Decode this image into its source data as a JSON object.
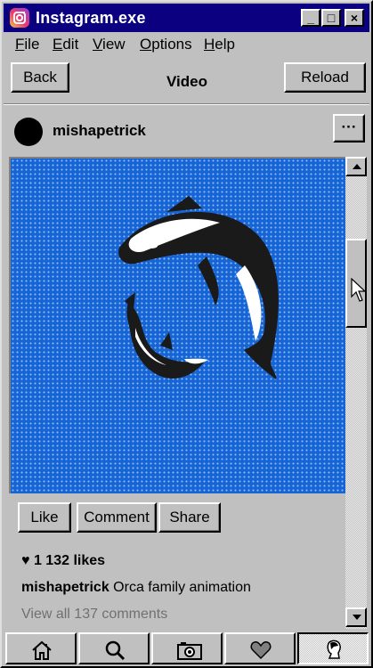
{
  "window": {
    "title": "Instagram.exe",
    "controls": {
      "minimize": "_",
      "maximize": "□",
      "close": "×"
    }
  },
  "menu": [
    {
      "key": "F",
      "rest": "ile"
    },
    {
      "key": "E",
      "rest": "dit"
    },
    {
      "key": "V",
      "rest": "iew"
    },
    {
      "key": "O",
      "rest": "ptions"
    },
    {
      "key": "H",
      "rest": "elp"
    }
  ],
  "header": {
    "back_label": "Back",
    "title": "Video",
    "reload_label": "Reload"
  },
  "post": {
    "username": "mishapetrick",
    "more_label": "···",
    "actions": {
      "like": "Like",
      "comment": "Comment",
      "share": "Share"
    },
    "likes": "1 132 likes",
    "caption_user": "mishapetrick",
    "caption_text": "Orca family animation",
    "comments_link": "View all 137 comments"
  },
  "icons": {
    "home": "home-icon",
    "search": "search-icon",
    "camera": "camera-icon",
    "likes": "heart-icon",
    "profile": "profile-icon"
  },
  "colors": {
    "titlebar": "#0a0080",
    "media_bg": "#1565d6",
    "window": "#c0c0c0"
  }
}
